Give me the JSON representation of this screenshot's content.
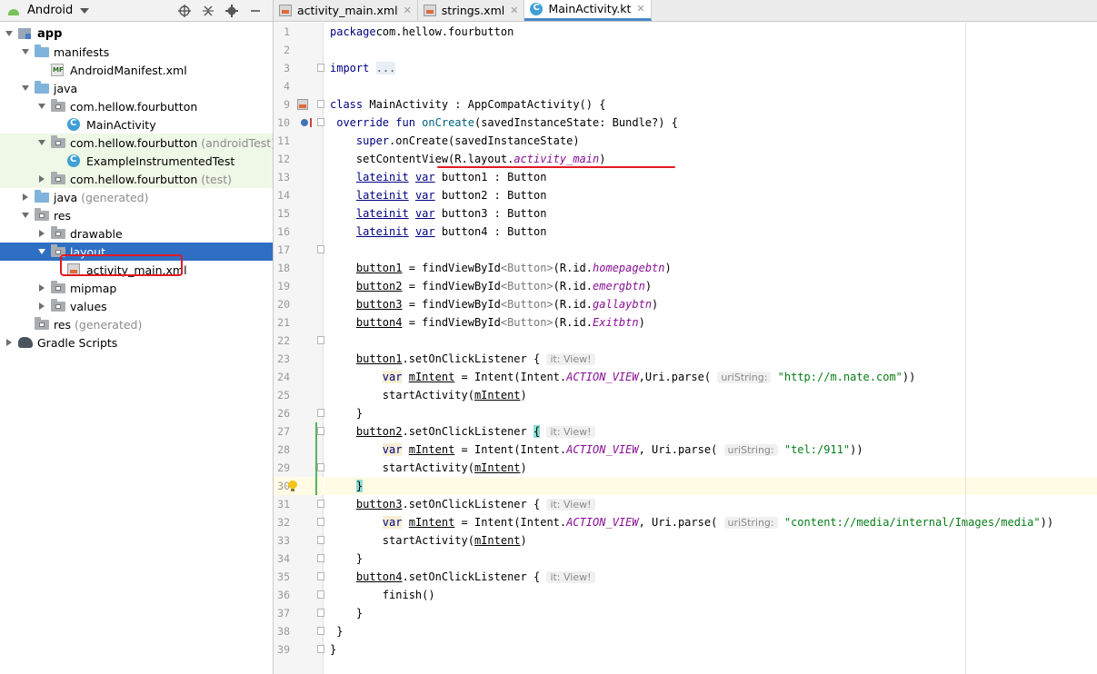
{
  "project_panel": {
    "view_label": "Android",
    "tools": [
      "target-icon",
      "collapse-icon",
      "gear-icon",
      "minimize-icon"
    ],
    "tree": [
      {
        "label": "app",
        "suffix": "",
        "depth": 0,
        "arrow": "down",
        "icon": "module-icon",
        "bold": true
      },
      {
        "label": "manifests",
        "suffix": "",
        "depth": 1,
        "arrow": "down",
        "icon": "folder-blue"
      },
      {
        "label": "AndroidManifest.xml",
        "suffix": "",
        "depth": 2,
        "arrow": "",
        "icon": "mf-icon"
      },
      {
        "label": "java",
        "suffix": "",
        "depth": 1,
        "arrow": "down",
        "icon": "folder-blue"
      },
      {
        "label": "com.hellow.fourbutton",
        "suffix": "",
        "depth": 2,
        "arrow": "down",
        "icon": "folder-gray"
      },
      {
        "label": "MainActivity",
        "suffix": "",
        "depth": 3,
        "arrow": "",
        "icon": "class-icon"
      },
      {
        "label": "com.hellow.fourbutton",
        "suffix": "(androidTest)",
        "depth": 2,
        "arrow": "down",
        "icon": "folder-gray",
        "green": true
      },
      {
        "label": "ExampleInstrumentedTest",
        "suffix": "",
        "depth": 3,
        "arrow": "",
        "icon": "class-icon",
        "green": true
      },
      {
        "label": "com.hellow.fourbutton",
        "suffix": "(test)",
        "depth": 2,
        "arrow": "right",
        "icon": "folder-gray",
        "green": true
      },
      {
        "label": "java",
        "suffix": "(generated)",
        "depth": 1,
        "arrow": "right",
        "icon": "folder-blue"
      },
      {
        "label": "res",
        "suffix": "",
        "depth": 1,
        "arrow": "down",
        "icon": "folder-gray"
      },
      {
        "label": "drawable",
        "suffix": "",
        "depth": 2,
        "arrow": "right",
        "icon": "folder-gray"
      },
      {
        "label": "layout",
        "suffix": "",
        "depth": 2,
        "arrow": "down",
        "icon": "folder-gray",
        "selected": true
      },
      {
        "label": "activity_main.xml",
        "suffix": "",
        "depth": 3,
        "arrow": "",
        "icon": "xml-icon"
      },
      {
        "label": "mipmap",
        "suffix": "",
        "depth": 2,
        "arrow": "right",
        "icon": "folder-gray"
      },
      {
        "label": "values",
        "suffix": "",
        "depth": 2,
        "arrow": "right",
        "icon": "folder-gray"
      },
      {
        "label": "res",
        "suffix": "(generated)",
        "depth": 1,
        "arrow": "",
        "icon": "folder-gray"
      },
      {
        "label": "Gradle Scripts",
        "suffix": "",
        "depth": 0,
        "arrow": "right",
        "icon": "gradle-icon"
      }
    ]
  },
  "editor": {
    "tabs": [
      {
        "label": "activity_main.xml",
        "icon": "xml-file-icon",
        "active": false
      },
      {
        "label": "strings.xml",
        "icon": "xml-file-icon",
        "active": false
      },
      {
        "label": "MainActivity.kt",
        "icon": "kotlin-class-icon",
        "active": true
      }
    ],
    "current_line": 30,
    "lines": [
      {
        "n": "1",
        "segs": [
          [
            "kw",
            "package"
          ],
          [
            "",
            "com.hellow.fourbutton"
          ]
        ]
      },
      {
        "n": "2",
        "segs": []
      },
      {
        "n": "3",
        "segs": [
          [
            "kw",
            "import"
          ],
          [
            "",
            " "
          ],
          [
            "fold-dots",
            "..."
          ]
        ]
      },
      {
        "n": "4",
        "segs": []
      },
      {
        "n": "9",
        "segs": [
          [
            "kw",
            "class"
          ],
          [
            "",
            " MainActivity : AppCompatActivity() {"
          ]
        ]
      },
      {
        "n": "10",
        "segs": [
          [
            "",
            " "
          ],
          [
            "kw",
            "override fun"
          ],
          [
            "",
            " "
          ],
          [
            "fn",
            "onCreate"
          ],
          [
            "",
            "(savedInstanceState: Bundle?) {"
          ]
        ]
      },
      {
        "n": "11",
        "segs": [
          [
            "",
            "    "
          ],
          [
            "kw",
            "super"
          ],
          [
            "",
            ".onCreate(savedInstanceState)"
          ]
        ]
      },
      {
        "n": "12",
        "segs": [
          [
            "",
            "    setContentView(R."
          ],
          [
            "",
            "layout"
          ],
          [
            "",
            "."
          ],
          [
            "prop",
            "activity_main"
          ],
          [
            "",
            ")"
          ]
        ]
      },
      {
        "n": "13",
        "segs": [
          [
            "",
            "    "
          ],
          [
            "kw u",
            "lateinit"
          ],
          [
            "",
            " "
          ],
          [
            "kw u",
            "var"
          ],
          [
            "",
            " button1 : Button"
          ]
        ]
      },
      {
        "n": "14",
        "segs": [
          [
            "",
            "    "
          ],
          [
            "kw u",
            "lateinit"
          ],
          [
            "",
            " "
          ],
          [
            "kw u",
            "var"
          ],
          [
            "",
            " button2 : Button"
          ]
        ]
      },
      {
        "n": "15",
        "segs": [
          [
            "",
            "    "
          ],
          [
            "kw u",
            "lateinit"
          ],
          [
            "",
            " "
          ],
          [
            "kw u",
            "var"
          ],
          [
            "",
            " button3 : Button"
          ]
        ]
      },
      {
        "n": "16",
        "segs": [
          [
            "",
            "    "
          ],
          [
            "kw u",
            "lateinit"
          ],
          [
            "",
            " "
          ],
          [
            "kw u",
            "var"
          ],
          [
            "",
            " button4 : Button"
          ]
        ]
      },
      {
        "n": "17",
        "segs": []
      },
      {
        "n": "18",
        "segs": [
          [
            "",
            "    "
          ],
          [
            "u",
            "button1"
          ],
          [
            "",
            " = findViewById"
          ],
          [
            "generic",
            "<Button>"
          ],
          [
            "",
            "(R.id."
          ],
          [
            "prop",
            "homepagebtn"
          ],
          [
            "",
            ")"
          ]
        ]
      },
      {
        "n": "19",
        "segs": [
          [
            "",
            "    "
          ],
          [
            "u",
            "button2"
          ],
          [
            "",
            " = findViewById"
          ],
          [
            "generic",
            "<Button>"
          ],
          [
            "",
            "(R.id."
          ],
          [
            "prop",
            "emergbtn"
          ],
          [
            "",
            ")"
          ]
        ]
      },
      {
        "n": "20",
        "segs": [
          [
            "",
            "    "
          ],
          [
            "u",
            "button3"
          ],
          [
            "",
            " = findViewById"
          ],
          [
            "generic",
            "<Button>"
          ],
          [
            "",
            "(R.id."
          ],
          [
            "prop",
            "gallaybtn"
          ],
          [
            "",
            ")"
          ]
        ]
      },
      {
        "n": "21",
        "segs": [
          [
            "",
            "    "
          ],
          [
            "u",
            "button4"
          ],
          [
            "",
            " = findViewById"
          ],
          [
            "generic",
            "<Button>"
          ],
          [
            "",
            "(R.id."
          ],
          [
            "prop",
            "Exitbtn"
          ],
          [
            "",
            ")"
          ]
        ]
      },
      {
        "n": "22",
        "segs": []
      },
      {
        "n": "23",
        "segs": [
          [
            "",
            "    "
          ],
          [
            "u",
            "button1"
          ],
          [
            "",
            ".setOnClickListener { "
          ],
          [
            "hint",
            "it: View!"
          ]
        ]
      },
      {
        "n": "24",
        "segs": [
          [
            "",
            "        "
          ],
          [
            "kw var-bg",
            "var"
          ],
          [
            "",
            " "
          ],
          [
            "u",
            "mIntent"
          ],
          [
            "",
            " = Intent(Intent."
          ],
          [
            "prop",
            "ACTION_VIEW"
          ],
          [
            "",
            ",Uri.parse( "
          ],
          [
            "hint",
            "uriString:"
          ],
          [
            "",
            " "
          ],
          [
            "str",
            "\"http://m.nate.com\""
          ],
          [
            "",
            "))"
          ]
        ]
      },
      {
        "n": "25",
        "segs": [
          [
            "",
            "        startActivity("
          ],
          [
            "u",
            "mIntent"
          ],
          [
            "",
            ")"
          ]
        ]
      },
      {
        "n": "26",
        "segs": [
          [
            "",
            "    }"
          ]
        ]
      },
      {
        "n": "27",
        "segs": [
          [
            "",
            "    "
          ],
          [
            "u",
            "button2"
          ],
          [
            "",
            ".setOnClickListener "
          ],
          [
            "brace-hl",
            "{"
          ],
          [
            "",
            " "
          ],
          [
            "hint",
            "it: View!"
          ]
        ]
      },
      {
        "n": "28",
        "segs": [
          [
            "",
            "        "
          ],
          [
            "kw var-bg",
            "var"
          ],
          [
            "",
            " "
          ],
          [
            "u",
            "mIntent"
          ],
          [
            "",
            " = Intent(Intent."
          ],
          [
            "prop",
            "ACTION_VIEW"
          ],
          [
            "",
            ", Uri.parse( "
          ],
          [
            "hint",
            "uriString:"
          ],
          [
            "",
            " "
          ],
          [
            "str",
            "\"tel:/911\""
          ],
          [
            "",
            "))"
          ]
        ]
      },
      {
        "n": "29",
        "segs": [
          [
            "",
            "        startActivity("
          ],
          [
            "u",
            "mIntent"
          ],
          [
            "",
            ")"
          ]
        ]
      },
      {
        "n": "30",
        "segs": [
          [
            "",
            "    "
          ],
          [
            "brace-hl",
            "}"
          ]
        ]
      },
      {
        "n": "31",
        "segs": [
          [
            "",
            "    "
          ],
          [
            "u",
            "button3"
          ],
          [
            "",
            ".setOnClickListener { "
          ],
          [
            "hint",
            "it: View!"
          ]
        ]
      },
      {
        "n": "32",
        "segs": [
          [
            "",
            "        "
          ],
          [
            "kw var-bg",
            "var"
          ],
          [
            "",
            " "
          ],
          [
            "u",
            "mIntent"
          ],
          [
            "",
            " = Intent(Intent."
          ],
          [
            "prop",
            "ACTION_VIEW"
          ],
          [
            "",
            ", Uri.parse( "
          ],
          [
            "hint",
            "uriString:"
          ],
          [
            "",
            " "
          ],
          [
            "str",
            "\"content://media/internal/Images/media\""
          ],
          [
            "",
            "))"
          ]
        ]
      },
      {
        "n": "33",
        "segs": [
          [
            "",
            "        startActivity("
          ],
          [
            "u",
            "mIntent"
          ],
          [
            "",
            ")"
          ]
        ]
      },
      {
        "n": "34",
        "segs": [
          [
            "",
            "    }"
          ]
        ]
      },
      {
        "n": "35",
        "segs": [
          [
            "",
            "    "
          ],
          [
            "u",
            "button4"
          ],
          [
            "",
            ".setOnClickListener { "
          ],
          [
            "hint",
            "it: View!"
          ]
        ]
      },
      {
        "n": "36",
        "segs": [
          [
            "",
            "        finish()"
          ]
        ]
      },
      {
        "n": "37",
        "segs": [
          [
            "",
            "    }"
          ]
        ]
      },
      {
        "n": "38",
        "segs": [
          [
            "",
            " }"
          ]
        ]
      },
      {
        "n": "39",
        "segs": [
          [
            "",
            "}"
          ]
        ]
      }
    ]
  }
}
